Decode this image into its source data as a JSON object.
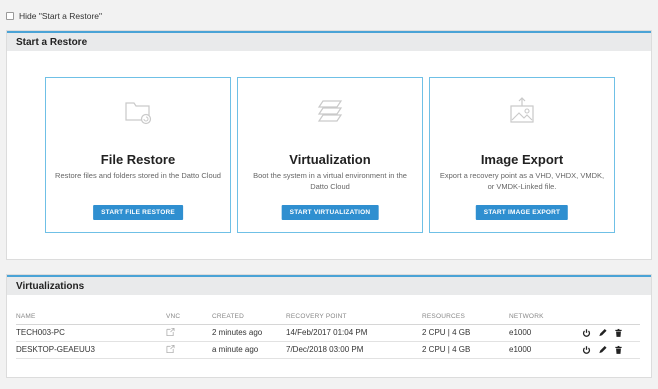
{
  "hide_toggle": {
    "label": "Hide \"Start a Restore\""
  },
  "restore_panel": {
    "title": "Start a Restore",
    "cards": [
      {
        "icon": "folder-restore-icon",
        "title": "File Restore",
        "description": "Restore files and folders stored in the Datto Cloud",
        "button": "START FILE RESTORE"
      },
      {
        "icon": "layers-icon",
        "title": "Virtualization",
        "description": "Boot the system in a virtual environment in the Datto Cloud",
        "button": "START VIRTUALIZATION"
      },
      {
        "icon": "image-export-icon",
        "title": "Image Export",
        "description": "Export a recovery point as a VHD, VHDX, VMDK, or VMDK-Linked file.",
        "button": "START IMAGE EXPORT"
      }
    ]
  },
  "virt_panel": {
    "title": "Virtualizations",
    "columns": [
      "NAME",
      "VNC",
      "CREATED",
      "RECOVERY POINT",
      "RESOURCES",
      "NETWORK"
    ],
    "rows": [
      {
        "name": "TECH003-PC",
        "created": "2 minutes ago",
        "recovery_point": "14/Feb/2017 01:04 PM",
        "resources": "2 CPU | 4 GB",
        "network": "e1000"
      },
      {
        "name": "DESKTOP-GEAEUU3",
        "created": "a minute ago",
        "recovery_point": "7/Dec/2018 03:00 PM",
        "resources": "2 CPU | 4 GB",
        "network": "e1000"
      }
    ]
  },
  "colors": {
    "accent": "#2f8fd0",
    "card_border": "#6fc0e6",
    "header_stripe": "#4aa3d6"
  }
}
